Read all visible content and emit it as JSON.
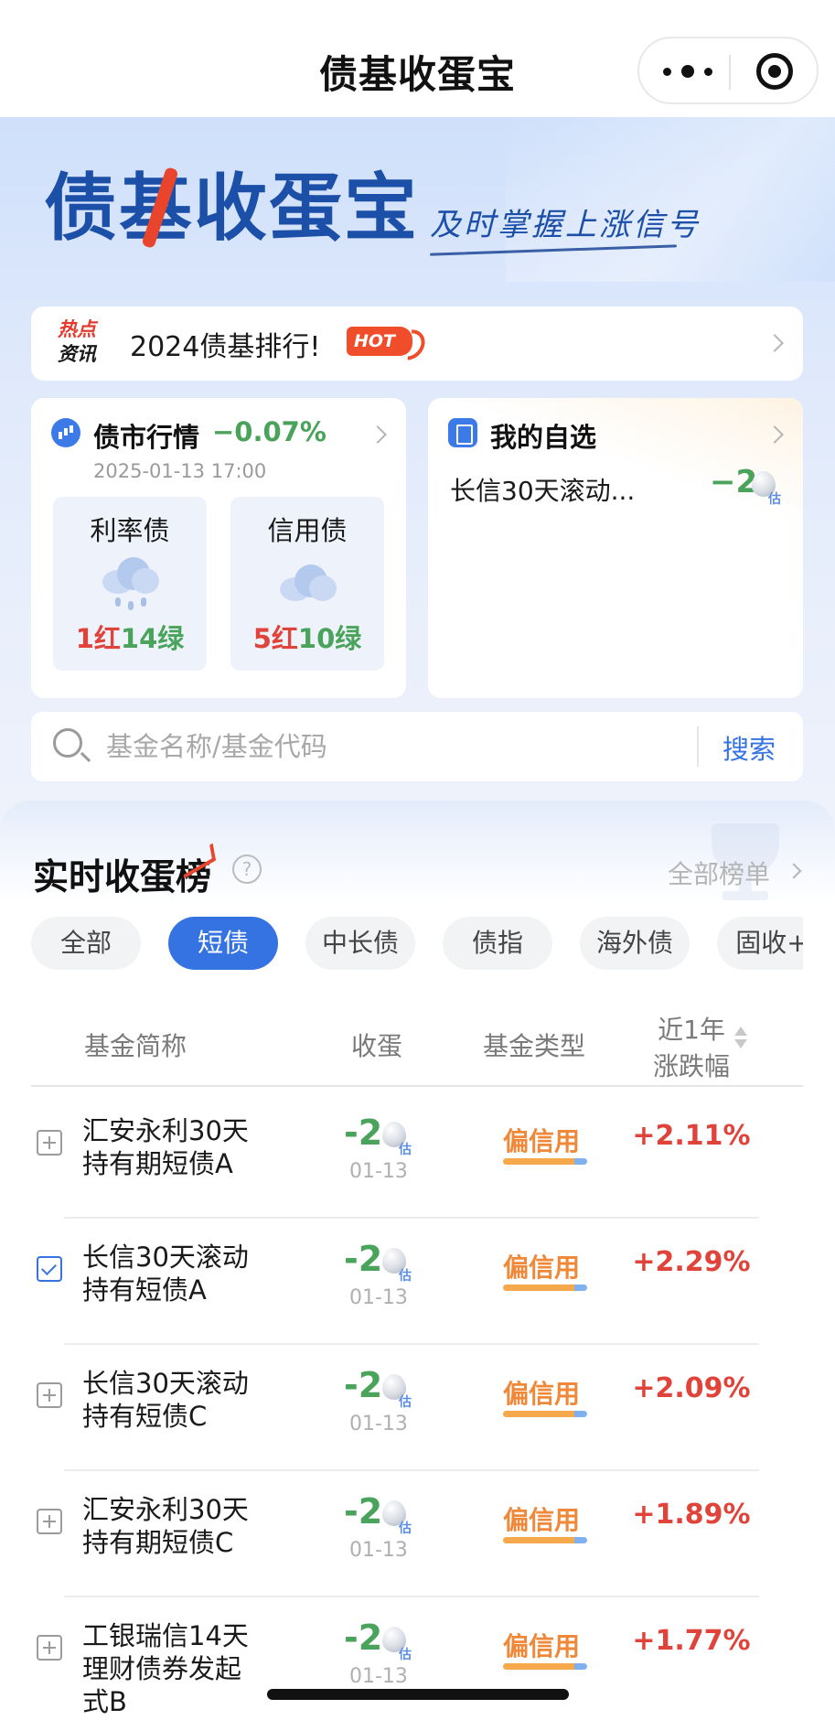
{
  "nav": {
    "title": "债基收蛋宝"
  },
  "banner": {
    "logo_text": "债基收蛋宝",
    "slogan": "及时掌握上涨信号"
  },
  "news": {
    "tag_line1": "热点",
    "tag_line2": "资讯",
    "text": "2024债基排行!",
    "badge": "HOT"
  },
  "market": {
    "title": "债市行情",
    "change": "−0.07%",
    "time": "2025-01-13 17:00",
    "items": [
      {
        "name": "利率债",
        "weather": "rain-cloud-icon",
        "red": "1红",
        "green": "14绿"
      },
      {
        "name": "信用债",
        "weather": "cloud-icon",
        "red": "5红",
        "green": "10绿"
      }
    ]
  },
  "watchlist": {
    "title": "我的自选",
    "fund_name": "长信30天滚动...",
    "value": "−2",
    "est_label": "估"
  },
  "search": {
    "placeholder": "基金名称/基金代码",
    "button": "搜索"
  },
  "ranking": {
    "title": "实时收蛋榜",
    "help": "?",
    "all_label": "全部榜单",
    "tabs": [
      "全部",
      "短债",
      "中长债",
      "债指",
      "海外债",
      "固收+"
    ],
    "active_tab": "短债",
    "headers": {
      "name": "基金简称",
      "eggs": "收蛋",
      "type": "基金类型",
      "change_l1": "近1年",
      "change_l2": "涨跌幅"
    },
    "rows": [
      {
        "l1": "汇安永利30天",
        "l2": "持有期短债A",
        "eggs": "-2",
        "est": "估",
        "date": "01-13",
        "type": "偏信用",
        "change": "+2.11%",
        "checked": false
      },
      {
        "l1": "长信30天滚动",
        "l2": "持有短债A",
        "eggs": "-2",
        "est": "估",
        "date": "01-13",
        "type": "偏信用",
        "change": "+2.29%",
        "checked": true
      },
      {
        "l1": "长信30天滚动",
        "l2": "持有短债C",
        "eggs": "-2",
        "est": "估",
        "date": "01-13",
        "type": "偏信用",
        "change": "+2.09%",
        "checked": false
      },
      {
        "l1": "汇安永利30天",
        "l2": "持有期短债C",
        "eggs": "-2",
        "est": "估",
        "date": "01-13",
        "type": "偏信用",
        "change": "+1.89%",
        "checked": false
      },
      {
        "l1": "工银瑞信14天",
        "l2": "理财债券发起",
        "l3": "式B",
        "eggs": "-2",
        "est": "估",
        "date": "01-13",
        "type": "偏信用",
        "change": "+1.77%",
        "checked": false
      }
    ]
  },
  "colors": {
    "accent": "#3573e3",
    "up": "#e0433a",
    "down": "#4aa35a",
    "type": "#f0883a"
  }
}
